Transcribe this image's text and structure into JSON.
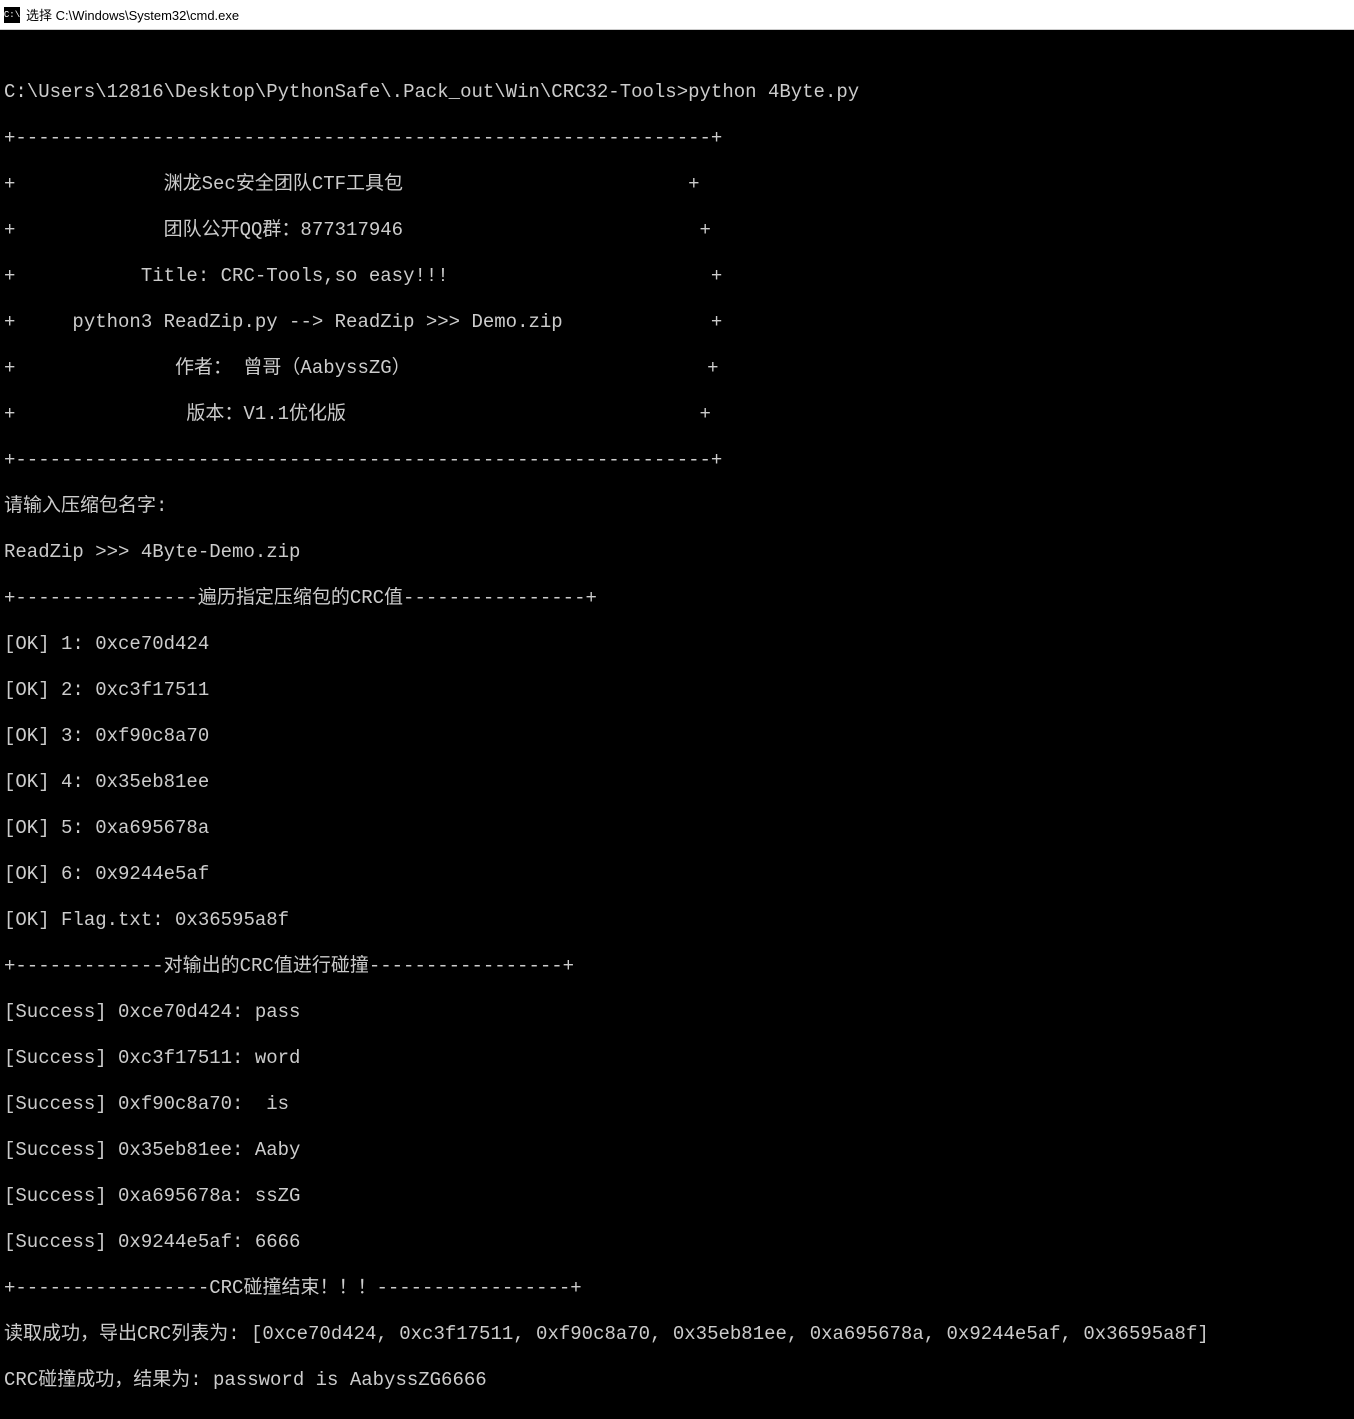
{
  "window": {
    "title": "选择 C:\\Windows\\System32\\cmd.exe"
  },
  "prompt": {
    "path": "C:\\Users\\12816\\Desktop\\PythonSafe\\.Pack_out\\Win\\CRC32-Tools>",
    "command": "python 4Byte.py"
  },
  "banner": {
    "top": "+-------------------------------------------------------------+",
    "l1": "+             渊龙Sec安全团队CTF工具包                         +",
    "l2": "+             团队公开QQ群：877317946                          +",
    "l3": "+           Title: CRC-Tools,so easy!!!                       +",
    "l4": "+     python3 ReadZip.py --> ReadZip >>> Demo.zip             +",
    "l5": "+              作者： 曾哥（AabyssZG）                          +",
    "l6": "+               版本：V1.1优化版                               +",
    "bot": "+-------------------------------------------------------------+"
  },
  "input_prompt": "请输入压缩包名字:",
  "readzip_line": "ReadZip >>> 4Byte-Demo.zip",
  "section1_header": "+----------------遍历指定压缩包的CRC值----------------+",
  "crc_entries": [
    "[OK] 1: 0xce70d424",
    "[OK] 2: 0xc3f17511",
    "[OK] 3: 0xf90c8a70",
    "[OK] 4: 0x35eb81ee",
    "[OK] 5: 0xa695678a",
    "[OK] 6: 0x9244e5af",
    "[OK] Flag.txt: 0x36595a8f"
  ],
  "section2_header": "+-------------对输出的CRC值进行碰撞-----------------+",
  "success_entries": [
    "[Success] 0xce70d424: pass",
    "[Success] 0xc3f17511: word",
    "[Success] 0xf90c8a70:  is ",
    "[Success] 0x35eb81ee: Aaby",
    "[Success] 0xa695678a: ssZG",
    "[Success] 0x9244e5af: 6666"
  ],
  "section3_header": "+-----------------CRC碰撞结束！！！-----------------+",
  "result1": "读取成功，导出CRC列表为: [0xce70d424, 0xc3f17511, 0xf90c8a70, 0x35eb81ee, 0xa695678a, 0x9244e5af, 0x36595a8f]",
  "result2": "CRC碰撞成功，结果为: password is AabyssZG6666"
}
